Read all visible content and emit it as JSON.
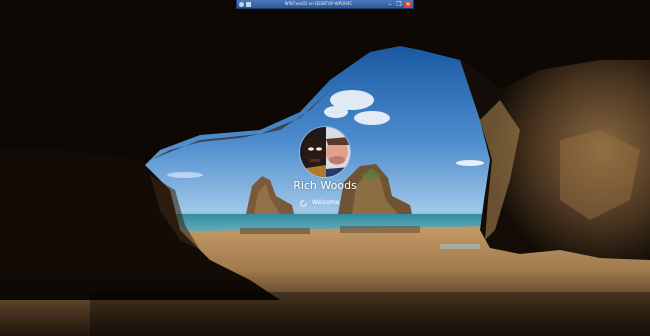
{
  "remote_session": {
    "title": "WIN7xxx02 on DESKTOP-WPOR4C",
    "minimize_symbol": "–",
    "restore_symbol": "❐",
    "close_symbol": "✕"
  },
  "lock_screen": {
    "username": "Rich Woods",
    "status_text": "Welcome"
  },
  "colors": {
    "sky_top": "#1f5fb5",
    "sky_bottom": "#9fc7ea",
    "sea": "#2a7d99",
    "sand": "#a9855a",
    "cave": "#2b1f14",
    "remote_bar": "#2d5a96"
  }
}
